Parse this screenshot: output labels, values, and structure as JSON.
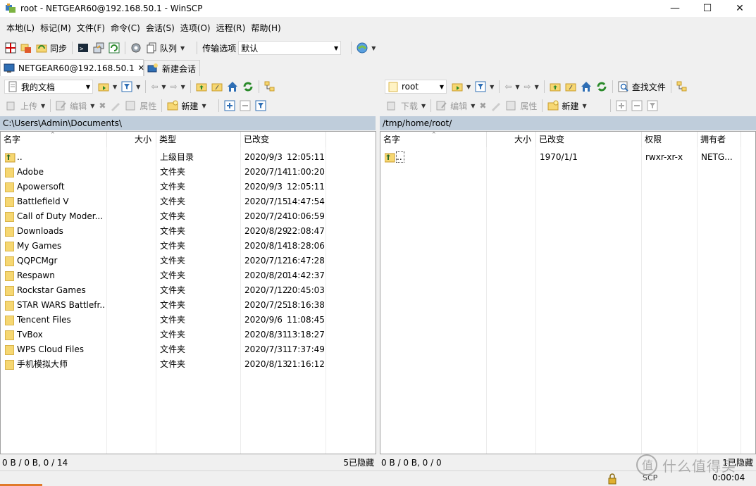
{
  "window": {
    "title": "root - NETGEAR60@192.168.50.1 - WinSCP",
    "controls": [
      "—",
      "☐",
      "✕"
    ]
  },
  "menu": [
    "本地(L)",
    "标记(M)",
    "文件(F)",
    "命令(C)",
    "会话(S)",
    "选项(O)",
    "远程(R)",
    "帮助(H)"
  ],
  "toolbar": {
    "sync_label": "同步",
    "queue_label": "队列",
    "transfer_options_label": "传输选项",
    "transfer_options_value": "默认"
  },
  "tabs": [
    {
      "label": "NETGEAR60@192.168.50.1",
      "close": "✕"
    },
    {
      "label": "新建会话"
    }
  ],
  "local": {
    "location": "我的文档",
    "upload_label": "上传",
    "edit_label": "编辑",
    "properties_label": "属性",
    "new_label": "新建",
    "path": "C:\\Users\\Admin\\Documents\\",
    "columns": {
      "name": "名字",
      "size": "大小",
      "type": "类型",
      "changed": "已改变"
    },
    "rows": [
      {
        "name": "..",
        "type": "上级目录",
        "date": "2020/9/3",
        "time": "12:05:11",
        "parent": true
      },
      {
        "name": "Adobe",
        "type": "文件夹",
        "date": "2020/7/14",
        "time": "11:00:20"
      },
      {
        "name": "Apowersoft",
        "type": "文件夹",
        "date": "2020/9/3",
        "time": "12:05:11"
      },
      {
        "name": "Battlefield V",
        "type": "文件夹",
        "date": "2020/7/15",
        "time": "14:47:54"
      },
      {
        "name": "Call of Duty Moder...",
        "type": "文件夹",
        "date": "2020/7/24",
        "time": "10:06:59"
      },
      {
        "name": "Downloads",
        "type": "文件夹",
        "date": "2020/8/29",
        "time": "22:08:47"
      },
      {
        "name": "My Games",
        "type": "文件夹",
        "date": "2020/8/14",
        "time": "18:28:06"
      },
      {
        "name": "QQPCMgr",
        "type": "文件夹",
        "date": "2020/7/12",
        "time": "16:47:28"
      },
      {
        "name": "Respawn",
        "type": "文件夹",
        "date": "2020/8/20",
        "time": "14:42:37"
      },
      {
        "name": "Rockstar Games",
        "type": "文件夹",
        "date": "2020/7/12",
        "time": "20:45:03"
      },
      {
        "name": "STAR WARS Battlefr...",
        "type": "文件夹",
        "date": "2020/7/25",
        "time": "18:16:38"
      },
      {
        "name": "Tencent Files",
        "type": "文件夹",
        "date": "2020/9/6",
        "time": "11:08:45"
      },
      {
        "name": "TvBox",
        "type": "文件夹",
        "date": "2020/8/31",
        "time": "13:18:27"
      },
      {
        "name": "WPS Cloud Files",
        "type": "文件夹",
        "date": "2020/7/31",
        "time": "17:37:49"
      },
      {
        "name": "手机模拟大师",
        "type": "文件夹",
        "date": "2020/8/13",
        "time": "21:16:12"
      }
    ],
    "status_left": "0 B / 0 B,  0 / 14",
    "status_right": "5已隐藏"
  },
  "remote": {
    "location": "root",
    "find_files_label": "查找文件",
    "download_label": "下载",
    "edit_label": "编辑",
    "properties_label": "属性",
    "new_label": "新建",
    "path": "/tmp/home/root/",
    "columns": {
      "name": "名字",
      "size": "大小",
      "changed": "已改变",
      "rights": "权限",
      "owner": "拥有者"
    },
    "rows": [
      {
        "name": "..",
        "date": "1970/1/1",
        "rights": "rwxr-xr-x",
        "owner": "NETG..."
      }
    ],
    "status_left": "0 B / 0 B,  0 / 0",
    "status_right": "1已隐藏"
  },
  "statusbar": {
    "protocol": "SCP",
    "elapsed": "0:00:04",
    "watermark": "什么值得买"
  },
  "colors": {
    "path_bar": "#bfcddb",
    "folder": "#f6d772",
    "accent": "#2f6fb5"
  }
}
